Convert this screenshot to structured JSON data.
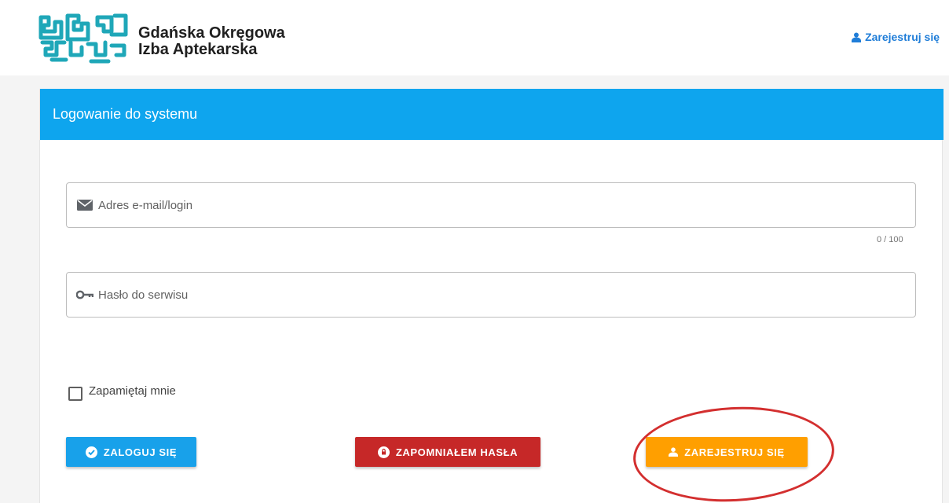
{
  "header": {
    "brand_line1": "Gdańska Okręgowa",
    "brand_line2": "Izba Aptekarska",
    "register_link": "Zarejestruj się",
    "brand_color": "#1fa7b8",
    "link_color": "#1f7dd8"
  },
  "card": {
    "title": "Logowanie do systemu",
    "header_color": "#0ea5ee"
  },
  "form": {
    "email_placeholder": "Adres e-mail/login",
    "email_icon": "envelope-icon",
    "email_counter": "0 / 100",
    "password_placeholder": "Hasło do serwisu",
    "password_icon": "key-icon",
    "remember_label": "Zapamiętaj mnie"
  },
  "buttons": {
    "login": "ZALOGUJ SIĘ",
    "forgot": "ZAPOMNIAŁEM HASŁA",
    "register": "ZAREJESTRUJ SIĘ",
    "login_color": "#18a1ea",
    "forgot_color": "#c62828",
    "register_color": "#ff9f00"
  },
  "annotation": {
    "color": "#d32f2f",
    "shape": "ellipse"
  }
}
